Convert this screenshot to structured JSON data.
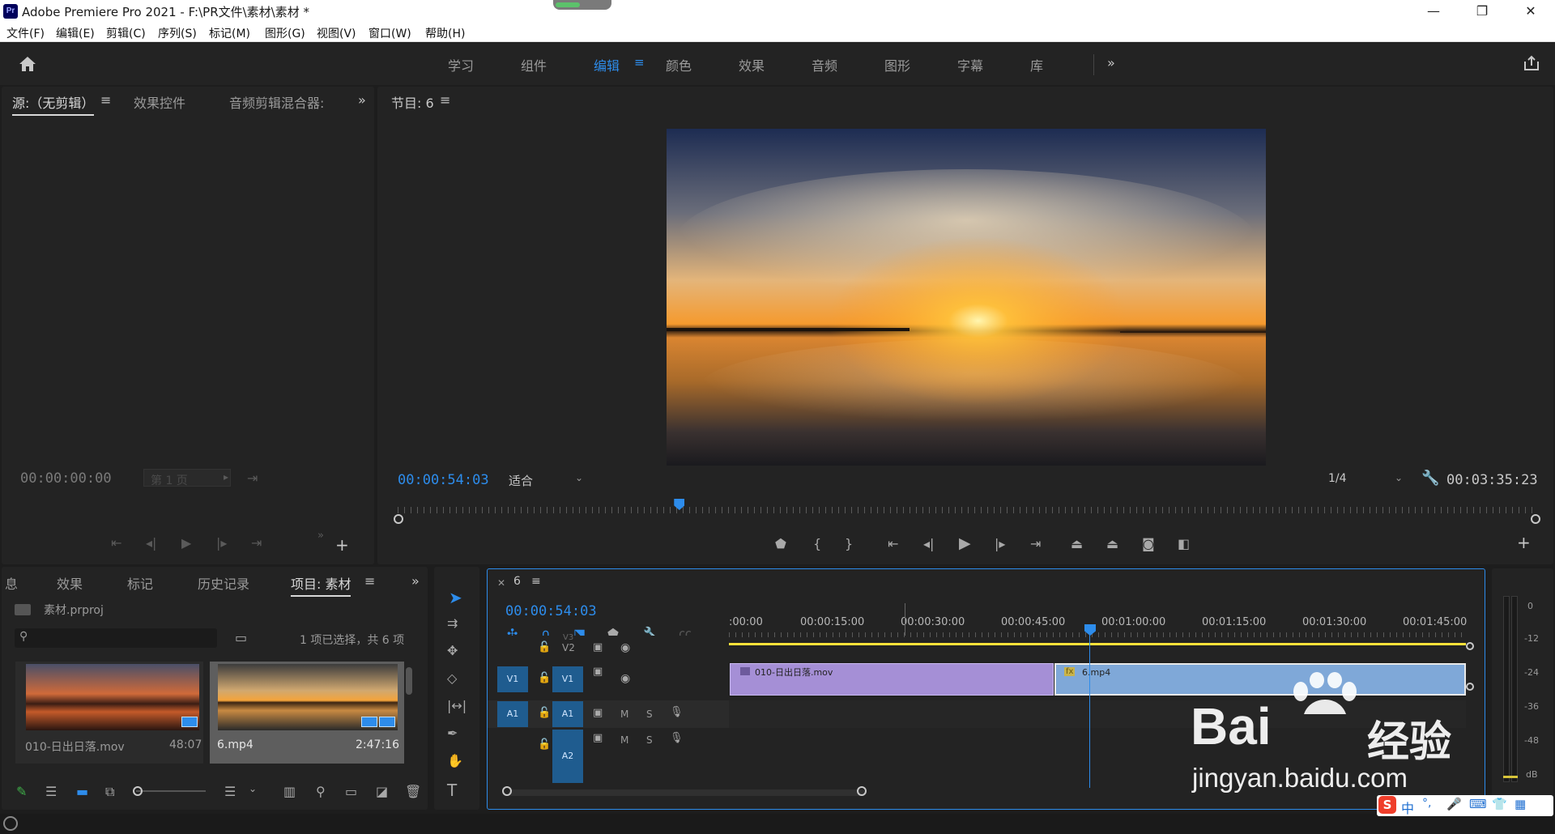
{
  "window": {
    "app_icon": "Pr",
    "title": "Adobe Premiere Pro 2021 - F:\\PR文件\\素材\\素材 *",
    "controls": [
      "minimize-icon",
      "restore-icon",
      "close-icon"
    ]
  },
  "menu": [
    "文件(F)",
    "编辑(E)",
    "剪辑(C)",
    "序列(S)",
    "标记(M)",
    "图形(G)",
    "视图(V)",
    "窗口(W)",
    "帮助(H)"
  ],
  "workspaces": {
    "items": [
      "学习",
      "组件",
      "编辑",
      "颜色",
      "效果",
      "音频",
      "图形",
      "字幕",
      "库"
    ],
    "active": "编辑",
    "overflow": "»"
  },
  "source_panel": {
    "tabs": [
      "源:（无剪辑）",
      "效果控件",
      "音频剪辑混合器:"
    ],
    "timecode": "00:00:00:00",
    "page_label": "第 1 页"
  },
  "program_panel": {
    "title": "节目: 6",
    "timecode": "00:00:54:03",
    "fit": "适合",
    "resolution": "1/4",
    "duration": "00:03:35:23",
    "playhead_fraction": 0.247
  },
  "project_panel": {
    "tabs": [
      "息",
      "效果",
      "标记",
      "历史记录",
      "项目: 素材"
    ],
    "project_file": "素材.prproj",
    "search_placeholder": "",
    "selection_info": "1 项已选择，共 6 项",
    "items": [
      {
        "name": "010-日出日落.mov",
        "duration": "48:07",
        "selected": false
      },
      {
        "name": "6.mp4",
        "duration": "2:47:16",
        "selected": true
      }
    ]
  },
  "timeline": {
    "tab": "6",
    "timecode": "00:00:54:03",
    "ruler_labels": [
      ":00:00",
      "00:00:15:00",
      "00:00:30:00",
      "00:00:45:00",
      "00:01:00:00",
      "00:01:15:00",
      "00:01:30:00",
      "00:01:45:00"
    ],
    "tracks": [
      {
        "src": "",
        "name": "V2",
        "kind": "video"
      },
      {
        "src": "V1",
        "name": "V1",
        "kind": "video"
      },
      {
        "src": "A1",
        "name": "A1",
        "kind": "audio",
        "m": "M",
        "s": "S"
      },
      {
        "src": "",
        "name": "A2",
        "kind": "audio",
        "m": "M",
        "s": "S"
      }
    ],
    "v3_label": "V3",
    "clips": [
      {
        "name": "010-日出日落.mov",
        "color": "#a58fd6"
      },
      {
        "name": "6.mp4",
        "color": "#7fa8d8",
        "fx": "fx"
      }
    ]
  },
  "audio_meter": {
    "scale": [
      "0",
      "-12",
      "-24",
      "-36",
      "-48",
      "dB"
    ]
  },
  "watermark": {
    "brand": "Bai",
    "brand_cn": "经验",
    "url": "jingyan.baidu.com"
  },
  "ime_bar": {
    "items": [
      "S",
      "中",
      "°,",
      "mic-icon",
      "keyboard-icon",
      "shirt-icon",
      "grid-icon"
    ]
  },
  "colors": {
    "accent": "#2d8ceb",
    "panel": "#232323",
    "background": "#1d1d1d",
    "clip_purple": "#a58fd6",
    "clip_blue": "#7fa8d8",
    "work_area": "#ffe23a"
  }
}
